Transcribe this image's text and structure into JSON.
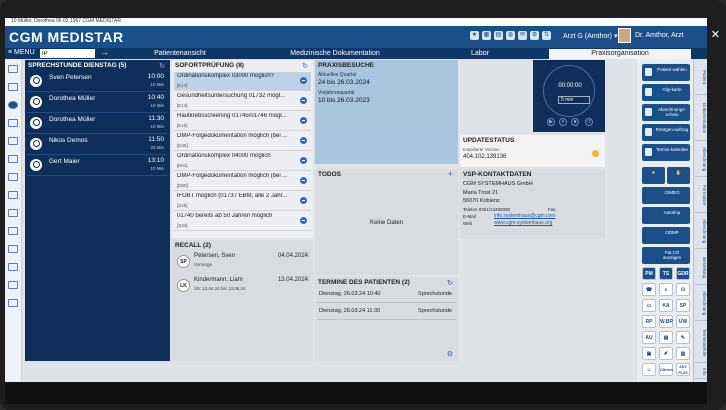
{
  "window": {
    "title_strip": "10 Müller, Dorothea 06.02.1967 CGM MEDISTAR",
    "close_glyph": "✕"
  },
  "header": {
    "app_title": "CGM MEDISTAR",
    "icons": [
      "user-star-icon",
      "table-icon",
      "print-icon",
      "globe-icon",
      "message-icon",
      "settings-icon",
      "arrows-icon"
    ],
    "doctor_select": "Arzt G (Amthor)",
    "user_name": "Dr. Amthor, Arzt"
  },
  "menubar": {
    "menu_label": "≡ MENU",
    "patient_input": "IP",
    "tabs": [
      {
        "label": "Patientenansicht",
        "active": false
      },
      {
        "label": "Medizinische Dokumentation",
        "active": false
      },
      {
        "label": "Labor",
        "active": false
      },
      {
        "label": "Praxisorganisation",
        "active": true
      }
    ]
  },
  "sprechstunde": {
    "title": "SPRECHSTUNDE DIENSTAG (5)",
    "rows": [
      {
        "name": "Sven Petersen",
        "time": "10:00",
        "duration": "10 Min"
      },
      {
        "name": "Dorothea Müller",
        "time": "10:40",
        "duration": "10 Min"
      },
      {
        "name": "Dorothea Müller",
        "time": "11:30",
        "duration": "10 Min"
      },
      {
        "name": "Nikos Demos",
        "time": "11:50",
        "duration": "20 Min"
      },
      {
        "name": "Gert Maier",
        "time": "13:10",
        "duration": "10 Min"
      }
    ]
  },
  "sofort": {
    "title": "SOFORTPRÜFUNG (8)",
    "items": [
      {
        "text": "Ordinationskomplex 03000 möglich?",
        "code": "[E13]",
        "selected": true
      },
      {
        "text": "Gesundheitsuntersuchung 01732 mögl...",
        "code": "[E14]",
        "selected": false
      },
      {
        "text": "Hautkrebsscreening 01745/01746 mögl...",
        "code": "[E15]",
        "selected": false
      },
      {
        "text": "DMP-Folgedokumentation möglich (bei ...",
        "code": "[D45]",
        "selected": false
      },
      {
        "text": "Ordinationskomplex 04000 möglich",
        "code": "[E01]",
        "selected": false
      },
      {
        "text": "DMP-Folgedokumentation möglich (bei ...",
        "code": "[D60]",
        "selected": false
      },
      {
        "text": "iFOBT möglich (01737 EBM, alle 2 Jahr...",
        "code": "[S29]",
        "selected": false
      },
      {
        "text": "01740 bereits ab 50 Jahren möglich",
        "code": "[S34]",
        "selected": false
      }
    ]
  },
  "recall": {
    "title": "RECALL (2)",
    "rows": [
      {
        "initials": "SP",
        "name": "Petersen, Sven",
        "date": "04.04.2024",
        "sub": "Vorsorge"
      },
      {
        "initials": "LK",
        "name": "Kindermann, Liam",
        "date": "13.04.2024",
        "sub": "U5: 13.04.24 bis 13.06.24"
      }
    ]
  },
  "praxisbesuche": {
    "title": "PRAXISBESUCHE",
    "current_label": "Aktuelles Quartal",
    "current_value": "24 bis 26.03.2024",
    "prev_label": "Vorjahresquartal",
    "prev_value": "10 bis 26.03.2023"
  },
  "todos": {
    "title": "TODOS",
    "add": "+",
    "empty": "Keine Daten"
  },
  "termine": {
    "title": "TERMINE DES PATIENTEN (2)",
    "rows": [
      {
        "date": "Dienstag, 26.03.24 10:40",
        "type": "Sprechstunde"
      },
      {
        "date": "Dienstag, 26.03.24 11:30",
        "type": "Sprechstunde"
      }
    ]
  },
  "timer": {
    "time": "00:00:00",
    "input": "5 min"
  },
  "update": {
    "title": "UPDATESTATUS",
    "label": "Installierte Version",
    "version": "404.102.139136",
    "status_color": "#f3b23a"
  },
  "vsp": {
    "title": "VSP-KONTAKTDATEN",
    "company": "CGM SYSTEMHAUS GmbH",
    "street": "Maria Trost 21",
    "city": "56070 Koblenz",
    "phone": "Telefon 0261/13492000",
    "fax": "Fax",
    "email_label": "E-Mail",
    "email": "info.systemhaus@cgm.com",
    "web_label": "Web",
    "web": "www.cgm-systemhaus.org"
  },
  "rightbar": {
    "buttons": [
      "Patient wählen",
      "Clip-karte",
      "Abrechnungs-schein",
      "Röntgen-auftrag",
      "Termin-kalender"
    ],
    "labels": [
      "GIMEO",
      "Autolmp",
      "ODMP",
      "Pat.CD anzeigen"
    ],
    "grid": [
      "PM",
      "TS",
      "GDR",
      "KA",
      "SP",
      "RP",
      "W.BP",
      "ÜW",
      "AU",
      "Clinics",
      "ADV PLUS"
    ]
  },
  "side_tabs": [
    "Patient",
    "Dokumentation",
    "Abrechnung",
    "Formulare",
    "Abrechnung",
    "Bestellung",
    "Abrechnung",
    "Terminaufrufe",
    "Info"
  ]
}
